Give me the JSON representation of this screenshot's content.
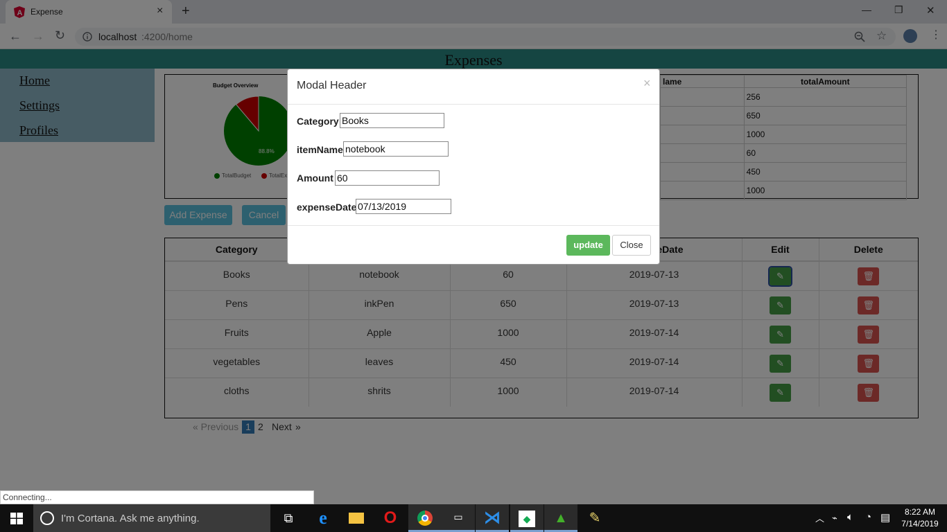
{
  "browser": {
    "tab_title": "Expense",
    "tab_close": "×",
    "new_tab": "+",
    "url_host": "localhost",
    "url_rest": ":4200/home",
    "min": "—",
    "max": "❐",
    "close": "✕"
  },
  "page": {
    "title": "Expenses",
    "nav": [
      "Home",
      "Settings",
      "Profiles"
    ],
    "chart": {
      "title": "Budget Overview",
      "percent_label": "88.8%",
      "legend": [
        "TotalBudget",
        "TotalEx"
      ]
    },
    "summary": {
      "headers": [
        "lame",
        "totalAmount"
      ],
      "rows": [
        "256",
        "650",
        "1000",
        "60",
        "450",
        "1000"
      ]
    },
    "buttons": {
      "add": "Add Expense",
      "cancel": "Cancel"
    },
    "table": {
      "headers": [
        "Category",
        "",
        "",
        "eDate",
        "Edit",
        "Delete"
      ],
      "rows": [
        [
          "Books",
          "notebook",
          "60",
          "2019-07-13"
        ],
        [
          "Pens",
          "inkPen",
          "650",
          "2019-07-13"
        ],
        [
          "Fruits",
          "Apple",
          "1000",
          "2019-07-14"
        ],
        [
          "vegetables",
          "leaves",
          "450",
          "2019-07-14"
        ],
        [
          "cloths",
          "shrits",
          "1000",
          "2019-07-14"
        ]
      ]
    },
    "pager": {
      "prev": "« Previous",
      "pages": [
        "1",
        "2"
      ],
      "next": "Next",
      "next_arrow": "»"
    }
  },
  "modal": {
    "header": "Modal Header",
    "close_x": "×",
    "fields": {
      "category_label": "Category :",
      "category_value": "Books",
      "item_label": "itemName :",
      "item_value": "notebook",
      "amount_label": "Amount :",
      "amount_value": "60",
      "date_label": "expenseDate :",
      "date_value": "07/13/2019"
    },
    "update": "update",
    "close": "Close"
  },
  "status": "Connecting...",
  "taskbar": {
    "cortana": "I'm Cortana. Ask me anything.",
    "time": "8:22 AM",
    "date": "7/14/2019"
  },
  "colors": {
    "accent_teal": "#2a8a84",
    "pie_green": "#008000",
    "pie_red": "#cc0000",
    "update_green": "#5cb85c"
  },
  "chart_data": {
    "type": "pie",
    "title": "Budget Overview",
    "categories": [
      "TotalBudget",
      "TotalEx"
    ],
    "values": [
      88.8,
      11.2
    ]
  }
}
